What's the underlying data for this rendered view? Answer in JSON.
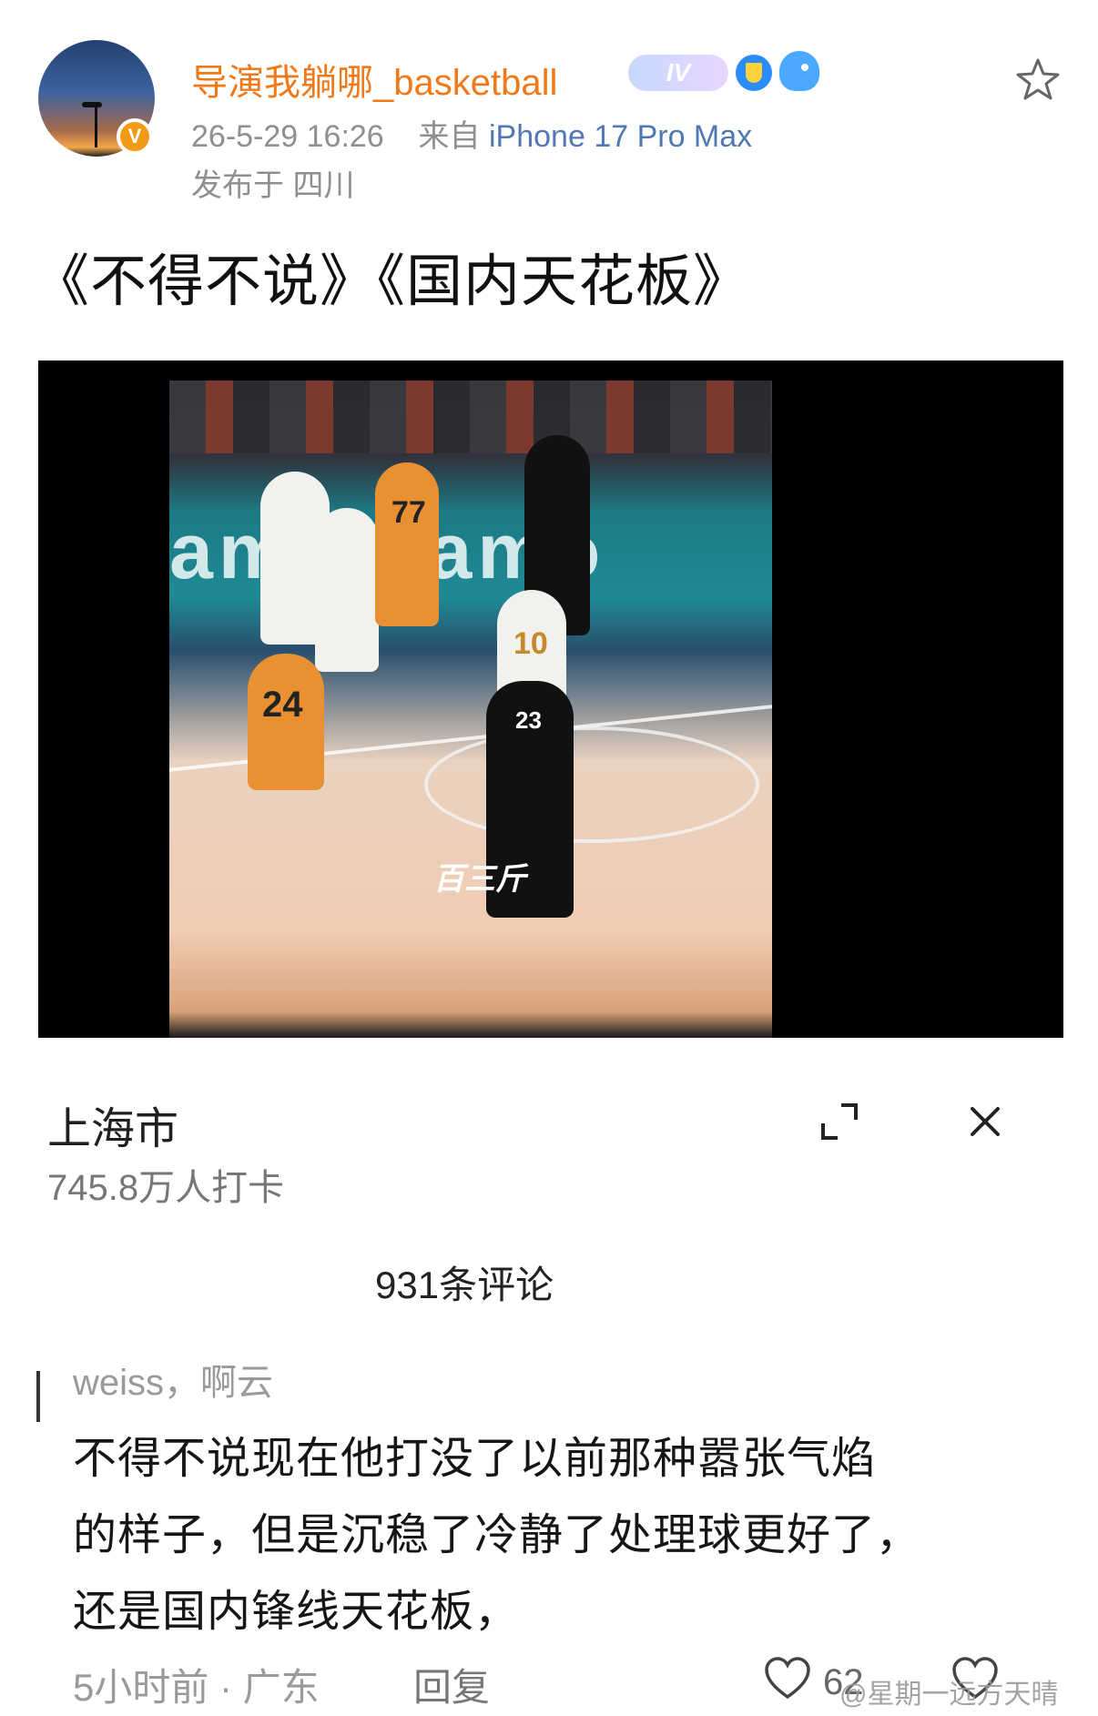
{
  "post": {
    "username": "导演我躺哪_basketball",
    "level_badge": "IV",
    "time": "26-5-29 16:26",
    "from_label": "来自",
    "device": "iPhone 17 Pro Max",
    "location": "发布于 四川",
    "text": "《不得不说》《国内天花板》"
  },
  "video": {
    "watermark": "百三斤",
    "jerseys": [
      "77",
      "10",
      "24",
      "23"
    ]
  },
  "overlay": {
    "city": "上海市",
    "checkins": "745.8万人打卡",
    "comment_count": "931条评论"
  },
  "comment": {
    "author": "weiss，啊云",
    "lines": [
      "不得不说现在他打没了以前那种嚣张气焰",
      "的样子，但是沉稳了冷静了处理球更好了，",
      "还是国内锋线天花板，"
    ],
    "time_location": "5小时前 · 广东",
    "reply_label": "回复",
    "likes": "62"
  },
  "watermark": "@星期一远方天晴",
  "icons": {
    "verified": "v-badge",
    "favorite": "star-icon",
    "expand": "expand-icon",
    "close": "close-icon",
    "like": "heart-icon"
  }
}
